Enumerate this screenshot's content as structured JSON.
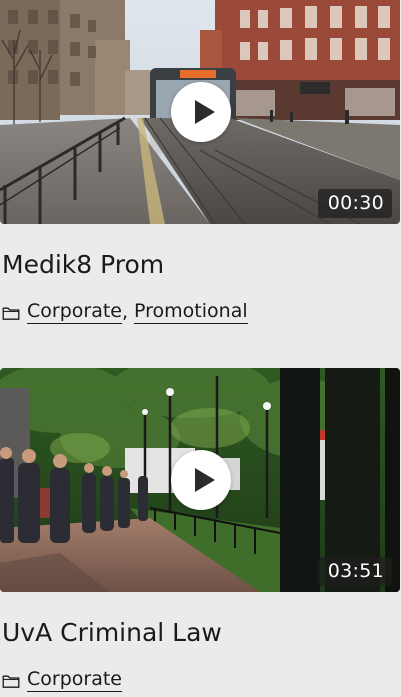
{
  "videos": [
    {
      "title": "Medik8 Prom",
      "duration": "00:30",
      "categories": [
        "Corporate",
        "Promotional"
      ],
      "separator": ","
    },
    {
      "title": "UvA Criminal Law",
      "duration": "03:51",
      "categories": [
        "Corporate"
      ]
    }
  ],
  "icons": {
    "play": "play-icon",
    "category": "folder-icon"
  },
  "colors": {
    "background": "#ebebeb",
    "text": "#1a1a1a",
    "play_button": "#ffffff",
    "duration_badge": "#1e1e1e"
  }
}
